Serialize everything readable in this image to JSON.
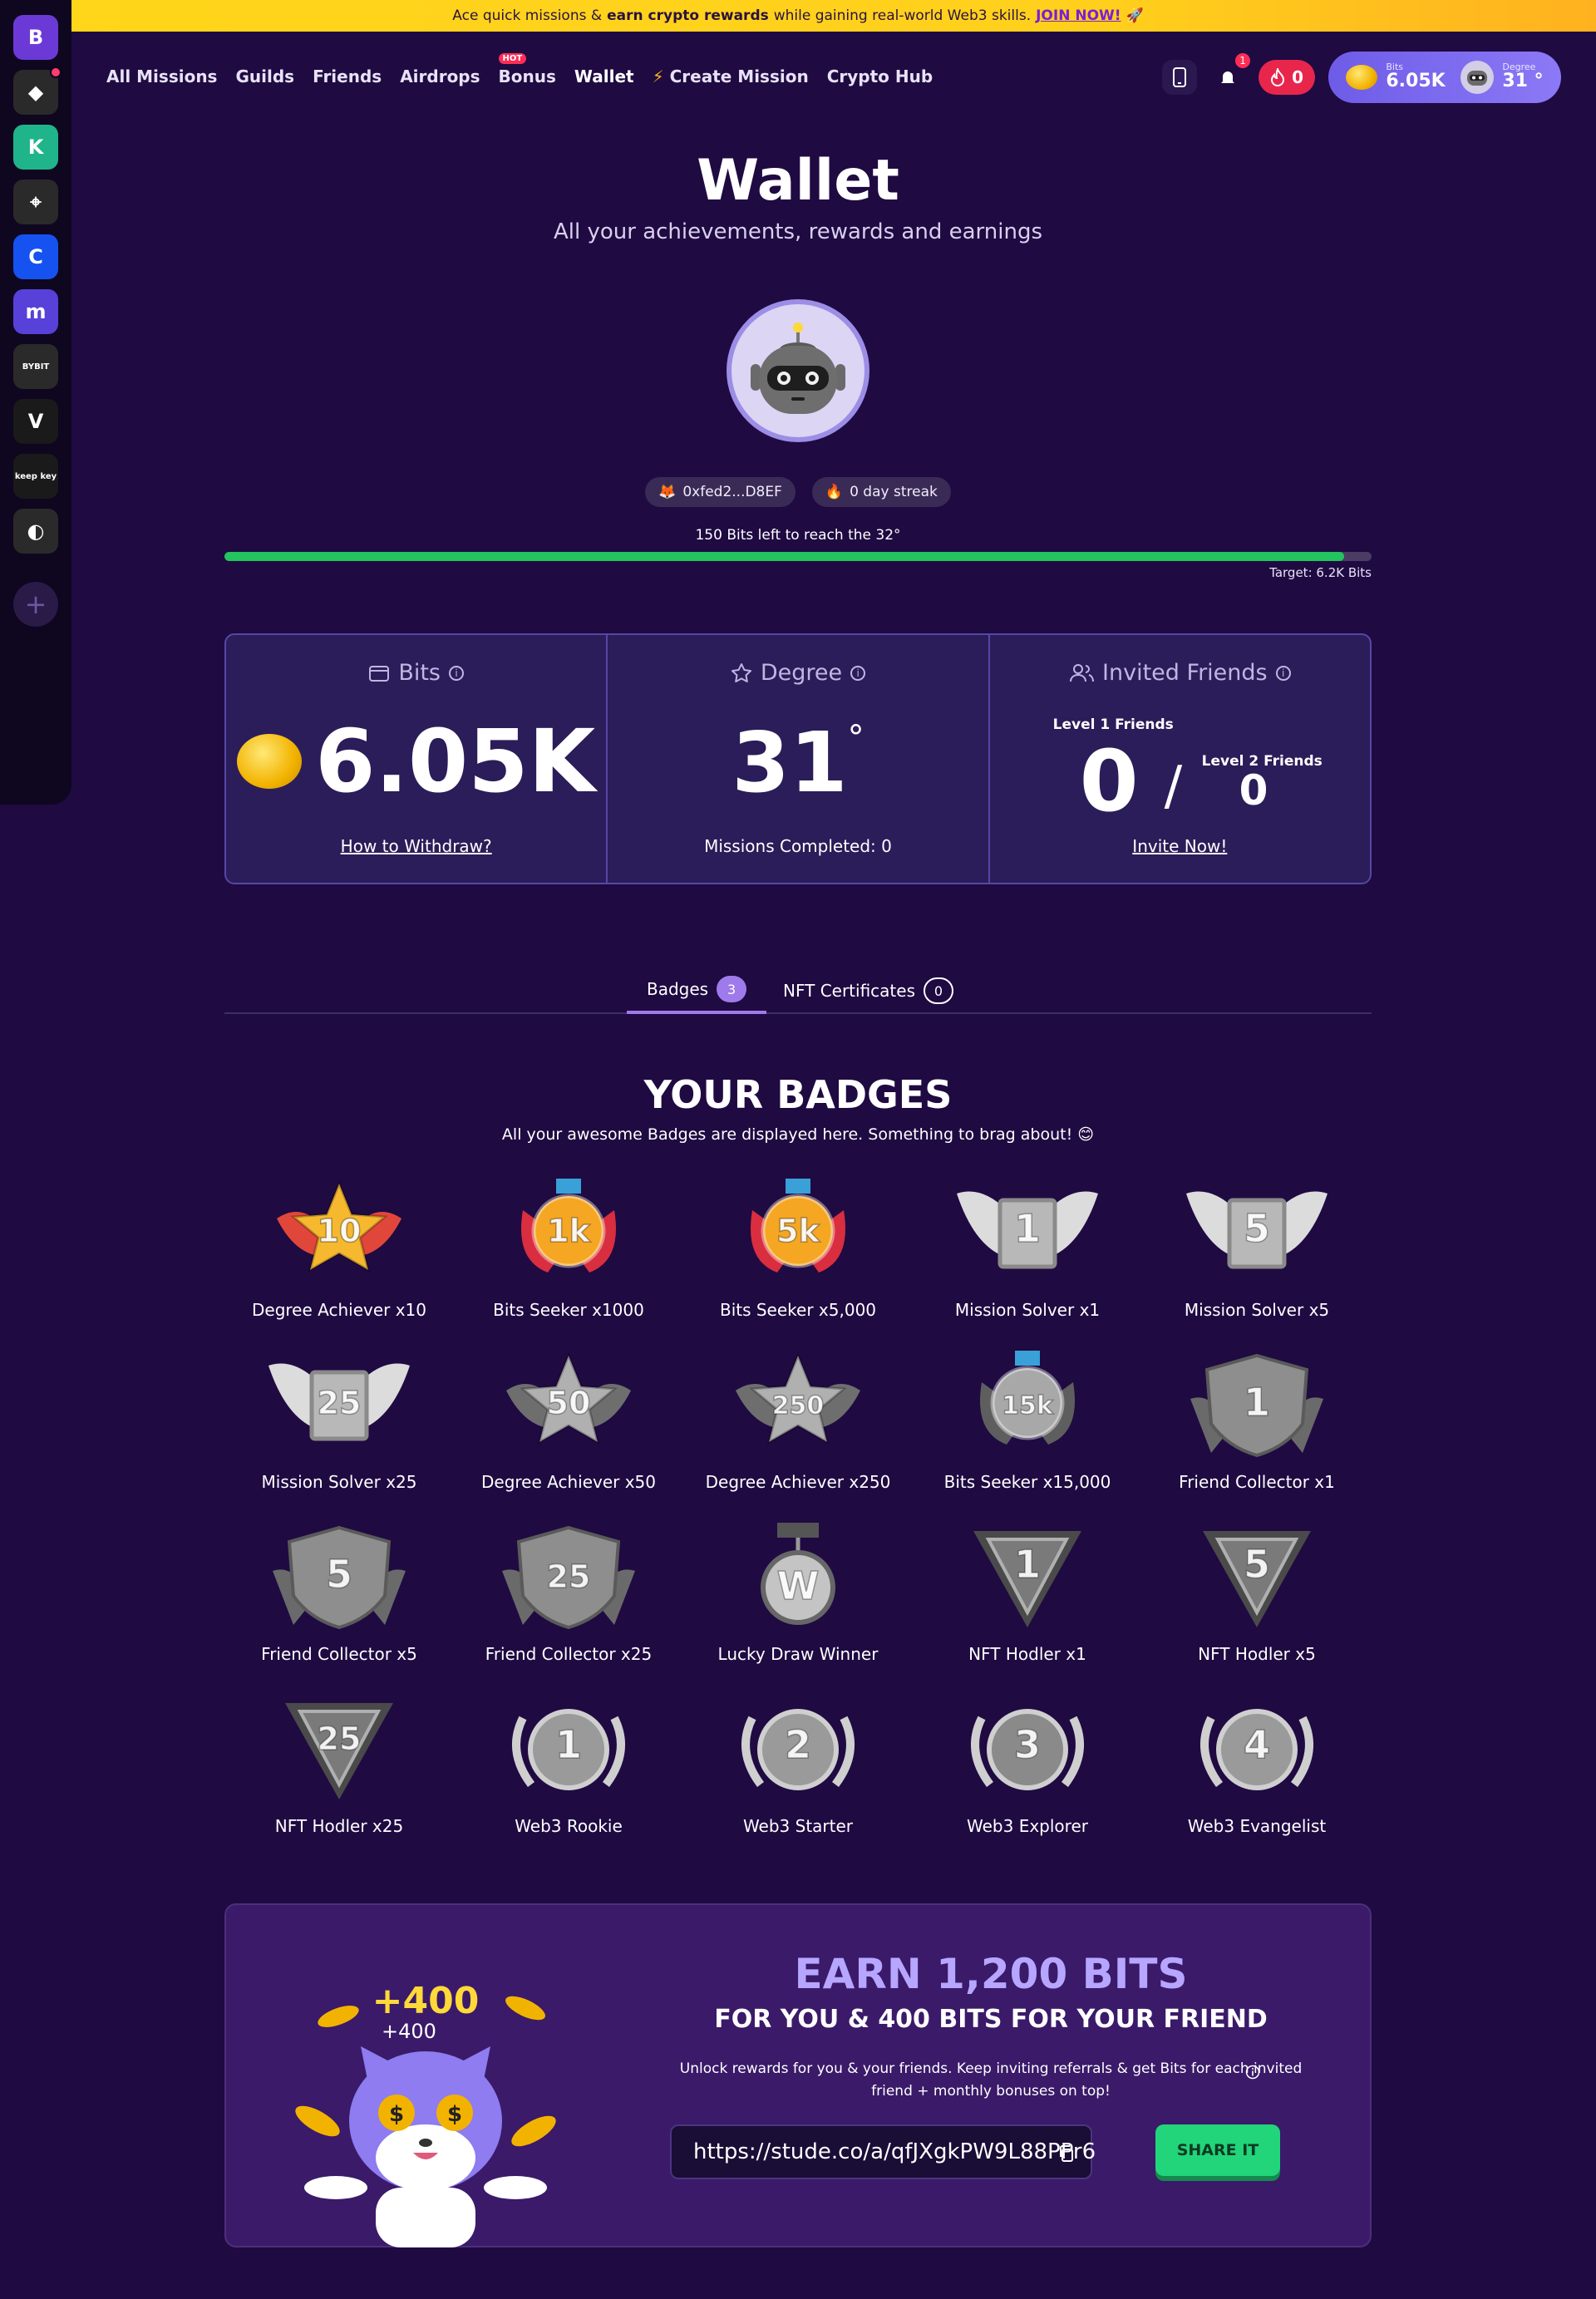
{
  "banner": {
    "pre": "Ace quick missions &",
    "bold": "earn crypto rewards",
    "post": "while gaining real-world Web3 skills.",
    "link": "JOIN NOW!"
  },
  "sidebar": {
    "items": [
      {
        "name": "stude-logo",
        "color": "#6b3ad6",
        "text": "B"
      },
      {
        "name": "binance",
        "color": "#2a2a2a",
        "text": "◆"
      },
      {
        "name": "kucoin",
        "color": "#1fb48a",
        "text": "K"
      },
      {
        "name": "scanner",
        "color": "#2a2a2a",
        "text": "⌖"
      },
      {
        "name": "coinbase",
        "color": "#1652f0",
        "text": "C"
      },
      {
        "name": "kraken",
        "color": "#5741d9",
        "text": "m"
      },
      {
        "name": "bybit",
        "color": "#2a2a2a",
        "text": "BYBIT"
      },
      {
        "name": "ayd-fi",
        "color": "#1a1a1a",
        "text": "V"
      },
      {
        "name": "keepkey",
        "color": "#1a1a1a",
        "text": "keep key"
      },
      {
        "name": "cycle",
        "color": "#2a2a2a",
        "text": "◐"
      }
    ]
  },
  "nav": {
    "items": [
      "All Missions",
      "Guilds",
      "Friends",
      "Airdrops",
      "Bonus",
      "Wallet",
      "Create Mission",
      "Crypto Hub"
    ],
    "hot": "HOT"
  },
  "header": {
    "notif_count": "1",
    "fire_count": "0",
    "bits_label": "Bits",
    "bits_value": "6.05K",
    "degree_label": "Degree",
    "degree_value": "31 °"
  },
  "page": {
    "title": "Wallet",
    "subtitle": "All your achievements, rewards and earnings"
  },
  "profile": {
    "wallet": "0xfed2...D8EF",
    "streak": "0 day streak",
    "progress_text": "150 Bits left to reach the 32°",
    "progress_pct": 97.6,
    "target": "Target: 6.2K Bits"
  },
  "stats": {
    "bits_label": "Bits",
    "bits_value": "6.05K",
    "withdraw_link": "How to Withdraw?",
    "degree_label": "Degree",
    "degree_value": "31",
    "degree_sup": "°",
    "missions": "Missions Completed: 0",
    "friends_label": "Invited Friends",
    "l1_label": "Level 1 Friends",
    "l1_value": "0",
    "slash": "/",
    "l2_label": "Level 2 Friends",
    "l2_value": "0",
    "invite_link": "Invite Now!"
  },
  "tabs": [
    {
      "label": "Badges",
      "count": "3"
    },
    {
      "label": "NFT Certificates",
      "count": "0"
    }
  ],
  "badges_section": {
    "title": "YOUR BADGES",
    "subtitle": "All your awesome Badges are displayed here. Something to brag about! 😊"
  },
  "badges": [
    {
      "name": "Degree Achiever x10",
      "mark": "10",
      "kind": "star",
      "color": "#f5b82e",
      "wing": "#e0473a"
    },
    {
      "name": "Bits Seeker x1000",
      "mark": "1k",
      "kind": "medal",
      "color": "#f5a623",
      "wing": "#d92e3f"
    },
    {
      "name": "Bits Seeker x5,000",
      "mark": "5k",
      "kind": "medal",
      "color": "#f5a623",
      "wing": "#d92e3f"
    },
    {
      "name": "Mission Solver x1",
      "mark": "1",
      "kind": "wings",
      "color": "#b8b8b8",
      "wing": "#dcdcdc"
    },
    {
      "name": "Mission Solver x5",
      "mark": "5",
      "kind": "wings",
      "color": "#b8b8b8",
      "wing": "#dcdcdc"
    },
    {
      "name": "Mission Solver x25",
      "mark": "25",
      "kind": "wings",
      "color": "#b8b8b8",
      "wing": "#dcdcdc"
    },
    {
      "name": "Degree Achiever x50",
      "mark": "50",
      "kind": "star",
      "color": "#b0b0b0",
      "wing": "#6e6e6e"
    },
    {
      "name": "Degree Achiever x250",
      "mark": "250",
      "kind": "star",
      "color": "#b0b0b0",
      "wing": "#6e6e6e"
    },
    {
      "name": "Bits Seeker x15,000",
      "mark": "15k",
      "kind": "medal",
      "color": "#a8a8a8",
      "wing": "#5e5e5e"
    },
    {
      "name": "Friend Collector x1",
      "mark": "1",
      "kind": "shield",
      "color": "#8e8e8e",
      "wing": "#6a6a6a"
    },
    {
      "name": "Friend Collector x5",
      "mark": "5",
      "kind": "shield",
      "color": "#8e8e8e",
      "wing": "#6a6a6a"
    },
    {
      "name": "Friend Collector x25",
      "mark": "25",
      "kind": "shield",
      "color": "#8e8e8e",
      "wing": "#6a6a6a"
    },
    {
      "name": "Lucky Draw Winner",
      "mark": "W",
      "kind": "hanging",
      "color": "#c4c4c4",
      "wing": "#8a8a8a"
    },
    {
      "name": "NFT Hodler x1",
      "mark": "1",
      "kind": "triangle",
      "color": "#7a7a7a",
      "wing": "#4a4a4a"
    },
    {
      "name": "NFT Hodler x5",
      "mark": "5",
      "kind": "triangle",
      "color": "#7a7a7a",
      "wing": "#4a4a4a"
    },
    {
      "name": "NFT Hodler x25",
      "mark": "25",
      "kind": "triangle",
      "color": "#7a7a7a",
      "wing": "#4a4a4a"
    },
    {
      "name": "Web3 Rookie",
      "mark": "1",
      "kind": "laurel",
      "color": "#9a9a9a",
      "wing": "#cfcfcf"
    },
    {
      "name": "Web3 Starter",
      "mark": "2",
      "kind": "laurel",
      "color": "#9a9a9a",
      "wing": "#cfcfcf"
    },
    {
      "name": "Web3 Explorer",
      "mark": "3",
      "kind": "laurel",
      "color": "#8a8a8a",
      "wing": "#cfcfcf"
    },
    {
      "name": "Web3 Evangelist",
      "mark": "4",
      "kind": "laurel",
      "color": "#9a9a9a",
      "wing": "#cfcfcf"
    }
  ],
  "earn": {
    "title": "EARN 1,200 BITS",
    "subtitle": "FOR YOU & 400 BITS FOR YOUR FRIEND",
    "desc": "Unlock rewards for you & your friends. Keep inviting referrals & get Bits for each invited friend + monthly bonuses on top!",
    "link": "https://stude.co/a/qfJXgkPW9L88PPr6",
    "share": "SHARE IT",
    "plus_big": "+400",
    "plus_small": "+400"
  }
}
